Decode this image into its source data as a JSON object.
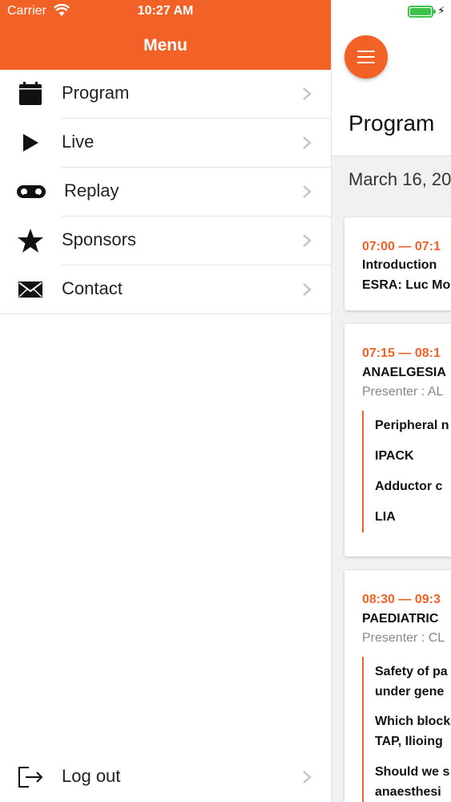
{
  "status_bar": {
    "carrier": "Carrier",
    "time": "10:27 AM"
  },
  "menu": {
    "title": "Menu",
    "items": [
      {
        "label": "Program",
        "icon": "calendar-icon"
      },
      {
        "label": "Live",
        "icon": "play-icon"
      },
      {
        "label": "Replay",
        "icon": "voicemail-icon"
      },
      {
        "label": "Sponsors",
        "icon": "star-icon"
      },
      {
        "label": "Contact",
        "icon": "envelope-icon"
      }
    ],
    "logout": {
      "label": "Log out",
      "icon": "logout-icon"
    }
  },
  "program": {
    "title": "Program",
    "date": "March 16, 20",
    "sessions": [
      {
        "time": "07:00 — 07:1",
        "title_lines": [
          "Introduction",
          "ESRA: Luc Mo"
        ]
      },
      {
        "time": "07:15 — 08:1",
        "title": "ANAELGESIA",
        "presenter": "Presenter : AL",
        "talks": [
          "Peripheral n",
          "IPACK",
          "Adductor c",
          "LIA"
        ]
      },
      {
        "time": "08:30 — 09:3",
        "title": "PAEDIATRIC",
        "presenter": "Presenter : CL",
        "talks": [
          [
            "Safety of pa",
            "under gene"
          ],
          [
            "Which block",
            "TAP, Ilioing"
          ],
          [
            "Should we s",
            "anaesthesi"
          ]
        ]
      }
    ]
  },
  "colors": {
    "accent": "#f26126",
    "battery": "#3ec34a"
  }
}
